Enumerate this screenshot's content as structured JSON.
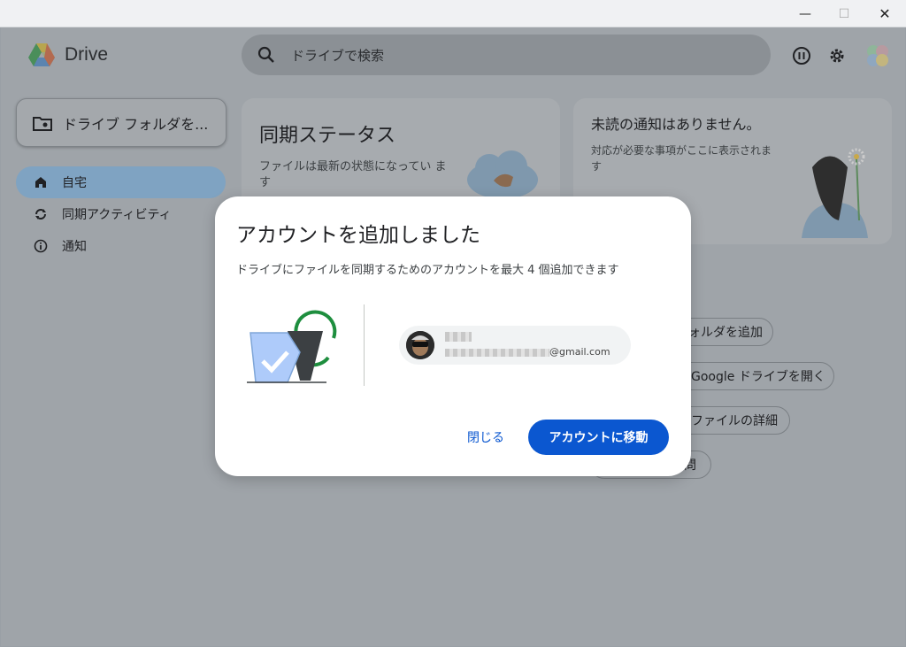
{
  "window": {
    "minimize_glyph": "—",
    "maximize_glyph": "☐",
    "close_glyph": "✕"
  },
  "app": {
    "name": "Drive",
    "search_placeholder": "ドライブで検索"
  },
  "sidebar": {
    "drive_folder_button": "ドライブ フォルダを...",
    "items": [
      {
        "label": "自宅",
        "icon": "home-icon",
        "active": true
      },
      {
        "label": "同期アクティビティ",
        "icon": "sync-icon",
        "active": false
      },
      {
        "label": "通知",
        "icon": "info-icon",
        "active": false
      }
    ]
  },
  "sync_card": {
    "title": "同期ステータス",
    "subtitle": "ファイルは最新の状態になってい ます"
  },
  "notification_card": {
    "title": "未読の通知はありません。",
    "subtitle": "対応が必要な事項がここに表示されま す"
  },
  "chips": [
    "ォルダを追加",
    "Google ドライブを開く",
    "ファイルの詳細",
    "問"
  ],
  "dialog": {
    "title": "アカウントを追加しました",
    "description": "ドライブにファイルを同期するためのアカウントを最大 4 個追加できます",
    "account_email_suffix": "@gmail.com",
    "close_label": "閉じる",
    "primary_label": "アカウントに移動"
  },
  "colors": {
    "primary": "#0b57d0",
    "active_nav": "#7fa3c2",
    "illustration_green": "#1e8e3e"
  }
}
